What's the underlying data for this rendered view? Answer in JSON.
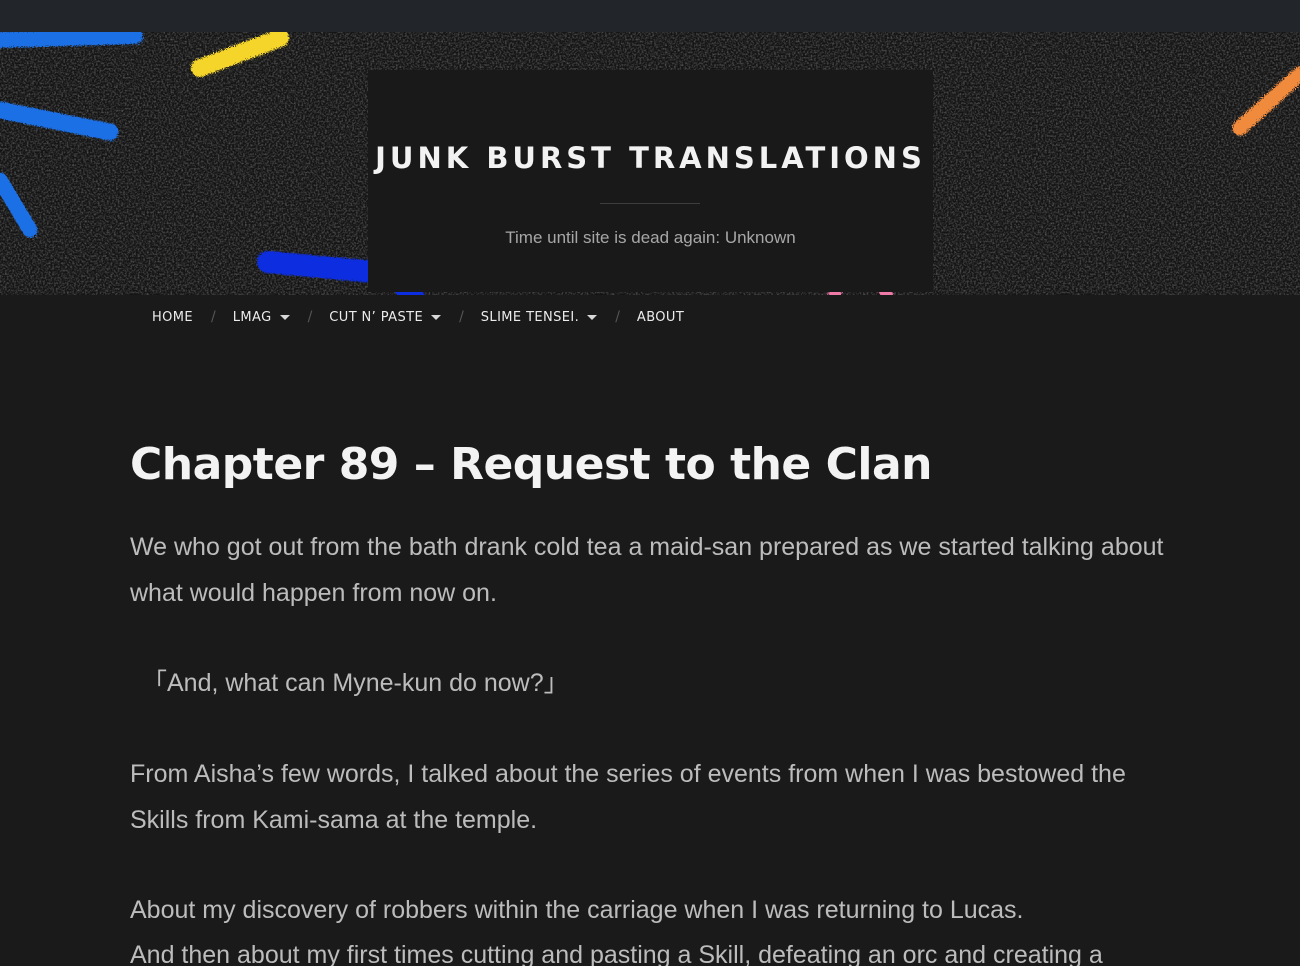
{
  "site": {
    "title": "JUNK BURST TRANSLATIONS",
    "tagline": "Time until site is dead again: Unknown"
  },
  "nav": {
    "items": [
      {
        "label": "HOME",
        "has_dropdown": false
      },
      {
        "label": "LMAG",
        "has_dropdown": true
      },
      {
        "label": "CUT N’ PASTE",
        "has_dropdown": true
      },
      {
        "label": "SLIME TENSEI.",
        "has_dropdown": true
      },
      {
        "label": "ABOUT",
        "has_dropdown": false
      }
    ],
    "separator": "/"
  },
  "post": {
    "title": "Chapter 89 – Request to the Clan",
    "paragraphs": [
      "We who got out from the bath drank cold tea a maid-san prepared as we started talking about what would happen from now on.",
      "「And, what can Myne-kun do now?」",
      "From Aisha’s few words, I talked about the series of events from when I was bestowed the Skills from Kami-sama at the temple.",
      "About my discovery of robbers within the carriage when I was returning to Lucas.",
      "And then about my first times cutting and pasting a Skill, defeating an orc and creating a"
    ]
  },
  "colors": {
    "page_bg": "#1a1a1b",
    "top_bar": "#22262b",
    "title_box": "#191919",
    "title_text": "#f2f2f2",
    "body_text": "#bcbcbc",
    "chalk_blue": "#1f6fe6",
    "chalk_deep_blue": "#0d2fe0",
    "chalk_yellow": "#f5d52a",
    "chalk_orange": "#f08a3c",
    "chalk_pink": "#ef7aa8"
  }
}
